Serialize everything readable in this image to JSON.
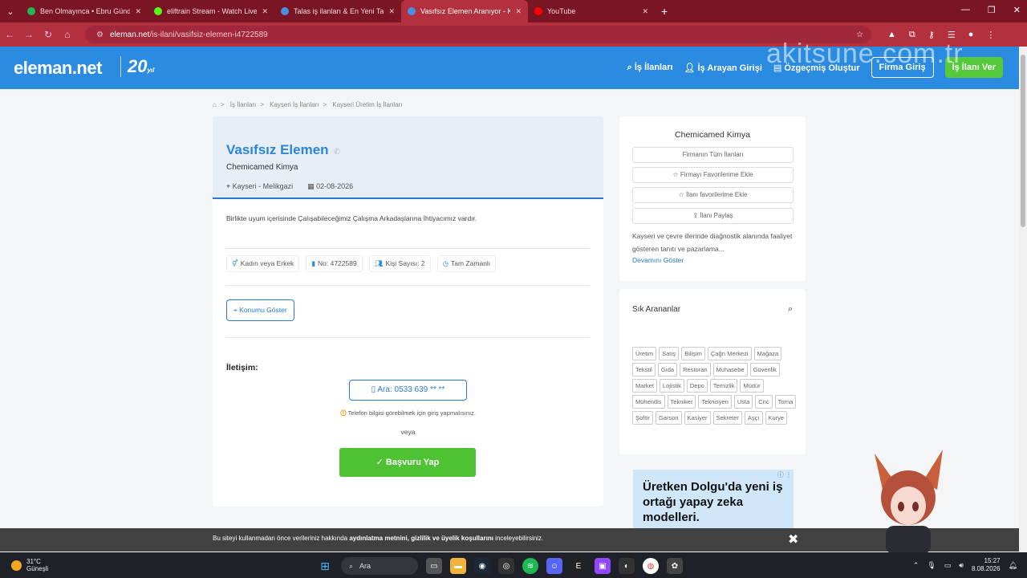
{
  "browser": {
    "tabs": [
      {
        "title": "Ben Olmayınca • Ebru Gündeş",
        "color": "#1db954",
        "active": false
      },
      {
        "title": "eliftrain Stream - Watch Live on",
        "color": "#53fc18",
        "active": false
      },
      {
        "title": "Talas iş ilanları & En Yeni Talas İş",
        "color": "#4a90e2",
        "active": false
      },
      {
        "title": "Vasıfsız Elemen Aranıyor - Kayse",
        "color": "#4a90e2",
        "active": true
      },
      {
        "title": "YouTube",
        "color": "#ff0000",
        "active": false
      }
    ],
    "url_host": "eleman.net",
    "url_path": "/is-ilani/vasifsiz-elemen-i4722589"
  },
  "site": {
    "logo": "eleman.net",
    "logo_badge": "20",
    "logo_badge_sub": "yıl",
    "watermark": "akitsune.com.tr",
    "nav": {
      "jobs": "İş İlanları",
      "seekers": "İş Arayan Girişi",
      "cv": "Özgeçmiş Oluştur",
      "company_login": "Firma Giriş",
      "post_job": "İş İlanı Ver"
    }
  },
  "breadcrumb": [
    "İş İlanları",
    "Kayseri İş İlanları",
    "Kayseri Üretim İş İlanları"
  ],
  "job": {
    "title": "Vasıfsız Elemen",
    "company": "Chemicamed Kimya",
    "location": "Kayseri - Melikgazi",
    "date": "02-08-2026",
    "description": "Birlikte uyum içerisinde Çalışabileceğimiz Çalışma Arkadaşlarına İhtiyacımız vardır.",
    "chips": {
      "gender": "Kadın veya Erkek",
      "number": "No: 4722589",
      "count": "Kişi Sayısı: 2",
      "type": "Tam Zamanlı"
    },
    "location_button": "Konumu Göster",
    "contact_label": "İletişim:",
    "call_button": "Ara: 0533 639 ** **",
    "phone_warning": "Telefon bilgisi görebilmek için giriş yapmalısınız.",
    "or_text": "veya",
    "apply_button": "Başvuru Yap"
  },
  "sidebar": {
    "company_name": "Chemicamed Kimya",
    "buttons": {
      "all_jobs": "Firmanın Tüm İlanları",
      "fav_company": "Firmayı Favorilerime Ekle",
      "fav_job": "İlanı favorilerime Ekle",
      "share": "İlanı Paylaş"
    },
    "about": "Kayseri ve çevre illerinde diağnostik alanında faaliyet gösteren tanıtı ve pazarlama...",
    "show_more": "Devamını Göster",
    "popular_title": "Sık Arananlar",
    "tags": [
      "Üretim",
      "Satış",
      "Bilişim",
      "Çağrı Merkezi",
      "Mağaza",
      "Tekstil",
      "Gıda",
      "Restoran",
      "Muhasebe",
      "Güvenlik",
      "Market",
      "Lojistik",
      "Depo",
      "Temizlik",
      "Müdür",
      "Mühendis",
      "Tekniker",
      "Teknisyen",
      "Usta",
      "Cnc",
      "Torna",
      "Şoför",
      "Garson",
      "Kasiyer",
      "Sekreter",
      "Aşçı",
      "Kurye"
    ],
    "ad_text": "Üretken Dolgu'da yeni iş ortağı yapay zeka modelleri."
  },
  "cookie": {
    "text_prefix": "Bu siteyi kullanmadan önce verileriniz hakkında ",
    "text_bold": "aydınlatma metnini, gizlilik ve üyelik koşullarını",
    "text_suffix": " inceleyebilirsiniz."
  },
  "taskbar": {
    "temp": "31°C",
    "weather": "Güneşli",
    "search": "Ara",
    "time": "15:27",
    "date": "8.08.2026"
  }
}
